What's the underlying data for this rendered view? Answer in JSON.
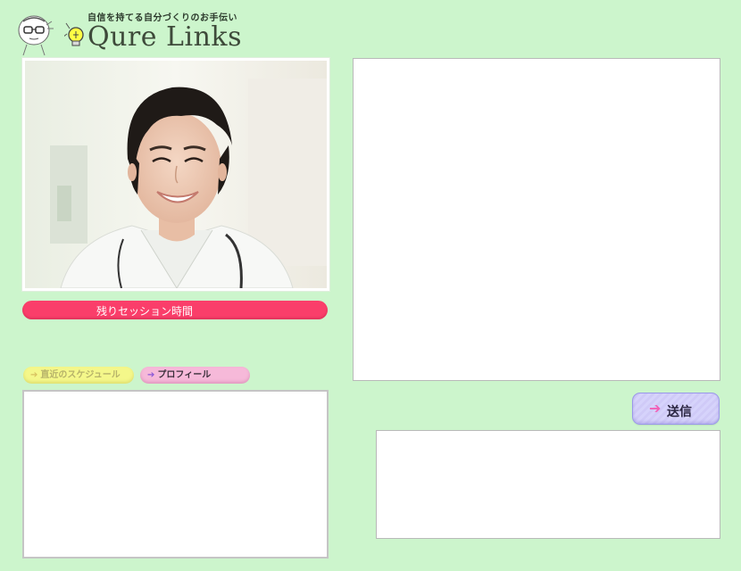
{
  "header": {
    "tagline": "自信を持てる自分づくりのお手伝い",
    "title": "Qure Links"
  },
  "session": {
    "remaining_label": "残りセッション時間"
  },
  "tabs": [
    {
      "label": "直近のスケジュール",
      "icon": "arrow-right-icon"
    },
    {
      "label": "プロフィール",
      "icon": "arrow-right-icon"
    }
  ],
  "composer": {
    "send_label": "送信",
    "send_icon": "arrow-right-icon"
  },
  "colors": {
    "background": "#ccf5cc",
    "session_bar": "#fa3e6a",
    "tab_schedule": "#f4f78a",
    "tab_profile": "#f6b9d9",
    "send_button": "#d6d3fb"
  }
}
